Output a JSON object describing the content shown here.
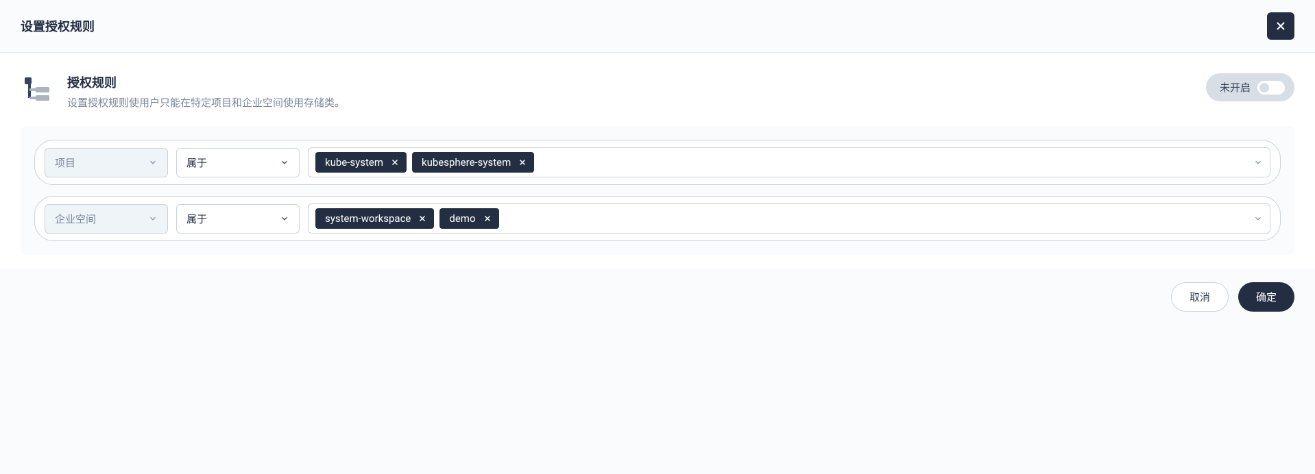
{
  "header": {
    "title": "设置授权规则"
  },
  "section": {
    "title": "授权规则",
    "description": "设置授权规则使用户只能在特定项目和企业空间使用存储类。",
    "toggle_label": "未开启"
  },
  "rules": [
    {
      "scope_label": "项目",
      "operator_label": "属于",
      "tags": [
        "kube-system",
        "kubesphere-system"
      ]
    },
    {
      "scope_label": "企业空间",
      "operator_label": "属于",
      "tags": [
        "system-workspace",
        "demo"
      ]
    }
  ],
  "footer": {
    "cancel_label": "取消",
    "confirm_label": "确定"
  }
}
